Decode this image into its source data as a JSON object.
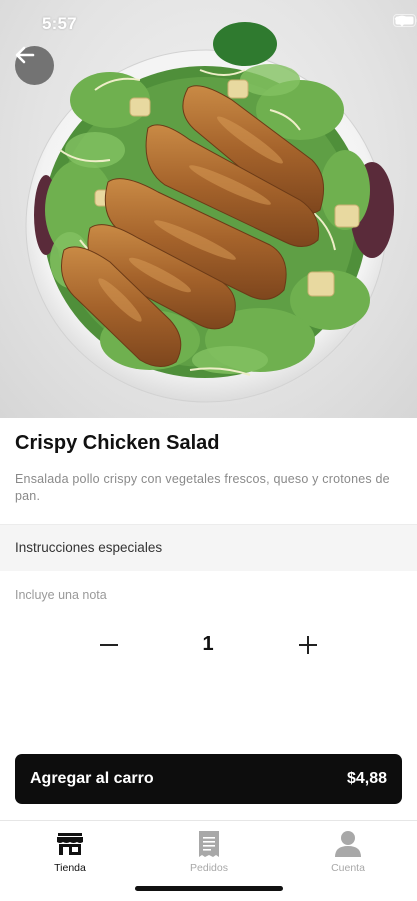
{
  "status_bar": {
    "time": "5:57"
  },
  "product": {
    "name": "Crispy Chicken Salad",
    "description": "Ensalada pollo crispy con vegetales frescos, queso y crotones de pan."
  },
  "special_instructions": {
    "header": "Instrucciones especiales",
    "note_placeholder": "Incluye una nota",
    "note_value": ""
  },
  "quantity": {
    "value": "1"
  },
  "cart_button": {
    "label": "Agregar al carro",
    "price": "$4,88"
  },
  "tabbar": {
    "items": [
      {
        "label": "Tienda",
        "icon": "store-icon",
        "active": true
      },
      {
        "label": "Pedidos",
        "icon": "receipt-icon",
        "active": false
      },
      {
        "label": "Cuenta",
        "icon": "user-icon",
        "active": false
      }
    ]
  },
  "colors": {
    "primary": "#0d0d0d",
    "inactive": "#a8a8a8",
    "muted_text": "#8a8a8a",
    "section_bg": "#f5f5f5"
  }
}
